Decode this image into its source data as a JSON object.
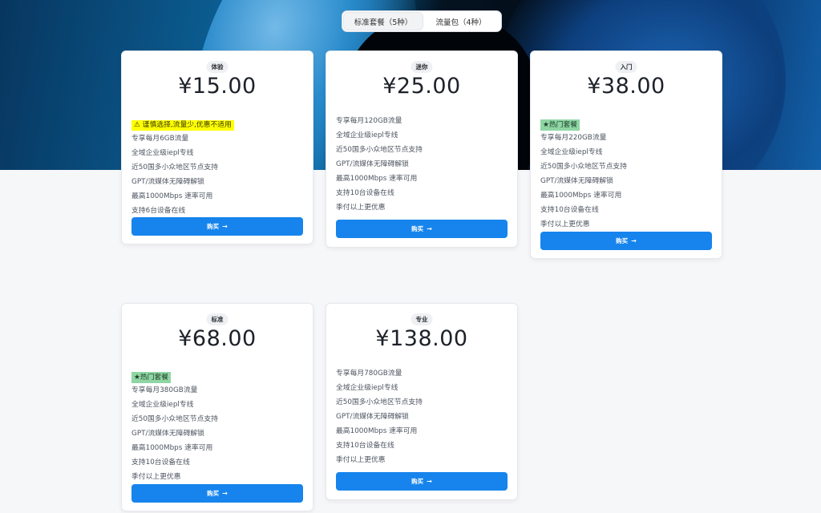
{
  "tabs": [
    {
      "label": "标准套餐（5种）",
      "active": true
    },
    {
      "label": "流量包（4种）",
      "active": false
    }
  ],
  "buy_label": "购买",
  "buy_arrow": "→",
  "plans": [
    {
      "badge": "体验",
      "price": "¥15.00",
      "note": "⚠ 谨慎选择,流量少,优惠不适用",
      "features": [
        "专享每月6GB流量",
        "全域企业级iepl专线",
        "近50国多小众地区节点支持",
        "GPT/流媒体无障碍解锁",
        "最高1000Mbps 速率可用",
        "支持6台设备在线"
      ]
    },
    {
      "badge": "迷你",
      "price": "¥25.00",
      "features": [
        "专享每月120GB流量",
        "全域企业级iepl专线",
        "近50国多小众地区节点支持",
        "GPT/流媒体无障碍解锁",
        "最高1000Mbps 速率可用",
        "支持10台设备在线",
        "季付以上更优惠"
      ]
    },
    {
      "badge": "入门",
      "price": "¥38.00",
      "note": "★热门套餐",
      "features": [
        "专享每月220GB流量",
        "全域企业级iepl专线",
        "近50国多小众地区节点支持",
        "GPT/流媒体无障碍解锁",
        "最高1000Mbps 速率可用",
        "支持10台设备在线",
        "季付以上更优惠"
      ]
    },
    {
      "badge": "标准",
      "price": "¥68.00",
      "note": "★热门套餐",
      "features": [
        "专享每月380GB流量",
        "全域企业级iepl专线",
        "近50国多小众地区节点支持",
        "GPT/流媒体无障碍解锁",
        "最高1000Mbps 速率可用",
        "支持10台设备在线",
        "季付以上更优惠"
      ]
    },
    {
      "badge": "专业",
      "price": "¥138.00",
      "features": [
        "专享每月780GB流量",
        "全域企业级iepl专线",
        "近50国多小众地区节点支持",
        "GPT/流媒体无障碍解锁",
        "最高1000Mbps 速率可用",
        "支持10台设备在线",
        "季付以上更优惠"
      ]
    }
  ]
}
